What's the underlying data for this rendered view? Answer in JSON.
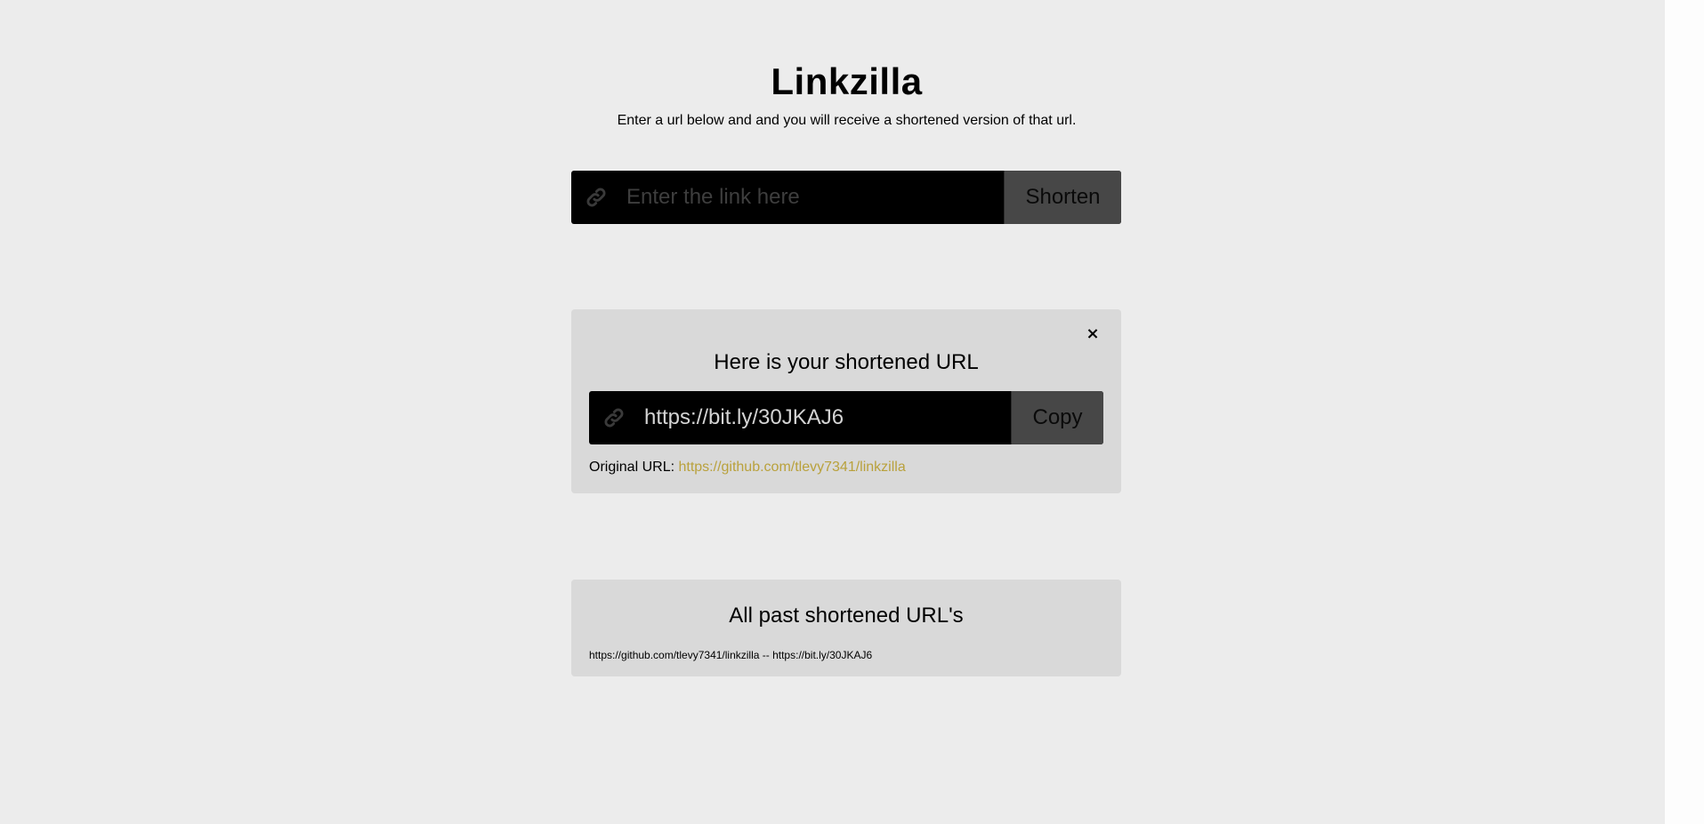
{
  "header": {
    "title": "Linkzilla",
    "subtitle": "Enter a url below and and you will receive a shortened version of that url."
  },
  "shortener": {
    "icon": "link-icon",
    "placeholder": "Enter the link here",
    "value": "",
    "button_label": "Shorten"
  },
  "result": {
    "close_label": "×",
    "heading": "Here is your shortened URL",
    "icon": "link-icon",
    "short_url": "https://bit.ly/30JKAJ6",
    "copy_label": "Copy",
    "original_label": "Original URL:",
    "original_url": "https://github.com/tlevy7341/linkzilla"
  },
  "history": {
    "heading": "All past shortened URL's",
    "items": [
      {
        "text": "https://github.com/tlevy7341/linkzilla -- https://bit.ly/30JKAJ6"
      }
    ]
  },
  "colors": {
    "background": "#ececec",
    "card": "#d9d9d9",
    "input_bg": "#000000",
    "button_bg": "#474747",
    "link": "#b9a13c"
  }
}
